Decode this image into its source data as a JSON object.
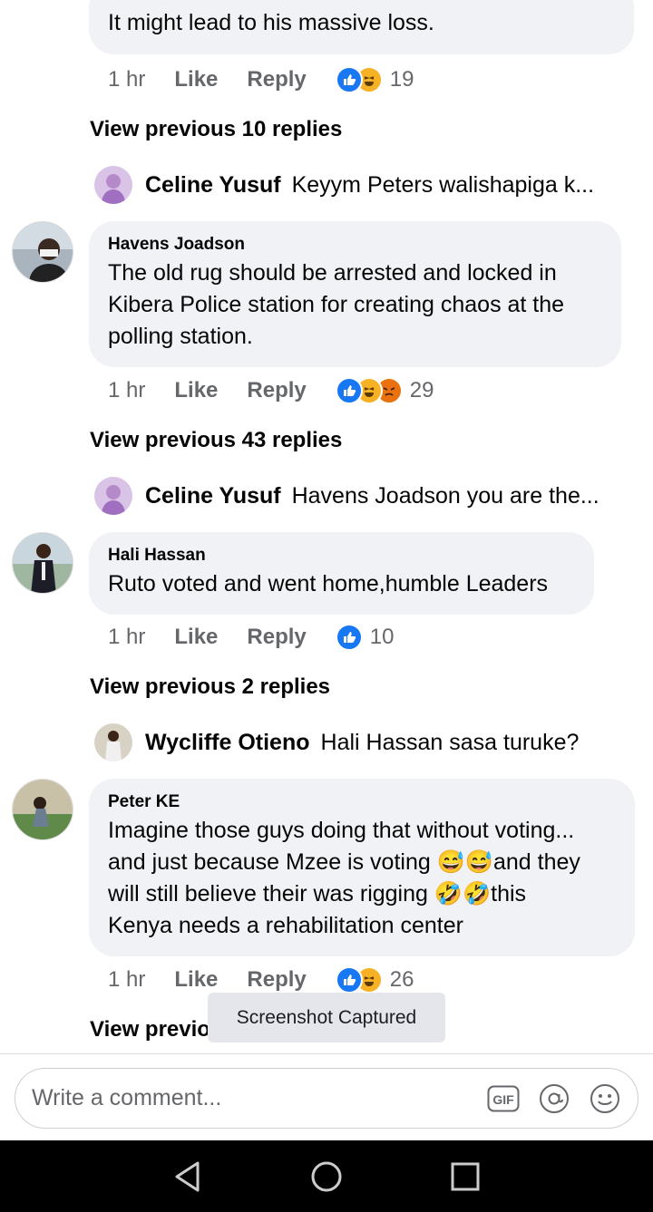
{
  "comments": [
    {
      "text": "It might lead to his massive loss.",
      "time": "1 hr",
      "like": "Like",
      "reply": "Reply",
      "count": "19",
      "view_previous": "View previous 10 replies",
      "reply_preview": {
        "name": "Celine Yusuf",
        "text": "Keyym Peters walishapiga k..."
      }
    },
    {
      "author": "Havens Joadson",
      "text_lines": [
        "The old rug should be arrested and locked in",
        "Kibera Police station for creating chaos at the",
        "polling station."
      ],
      "time": "1 hr",
      "like": "Like",
      "reply": "Reply",
      "count": "29",
      "view_previous": "View previous 43 replies",
      "reply_preview": {
        "name": "Celine Yusuf",
        "text": "Havens Joadson you are the..."
      }
    },
    {
      "author": "Hali Hassan",
      "text": "Ruto voted and went home,humble Leaders",
      "time": "1 hr",
      "like": "Like",
      "reply": "Reply",
      "count": "10",
      "view_previous": "View previous 2 replies",
      "reply_preview": {
        "name": "Wycliffe Otieno",
        "text": "Hali Hassan sasa turuke?"
      }
    },
    {
      "author": "Peter KE",
      "text_lines": [
        "Imagine those guys doing that without voting...",
        "and just because Mzee is voting 😅😅and they",
        "will still believe their was rigging 🤣🤣this",
        "Kenya needs a rehabilitation center"
      ],
      "time": "1 hr",
      "like": "Like",
      "reply": "Reply",
      "count": "26",
      "view_previous": "View previous reply"
    }
  ],
  "toast": "Screenshot Captured",
  "composer": {
    "placeholder": "Write a comment...",
    "gif_label": "GIF"
  },
  "colors": {
    "bubble": "#f0f2f5",
    "like_blue": "#1877f2",
    "haha_yellow": "#f7b125",
    "angry_orange": "#e9710f",
    "meta_gray": "#65676b"
  },
  "icons": [
    "like-reaction-icon",
    "haha-reaction-icon",
    "angry-reaction-icon",
    "gif-icon",
    "mention-icon",
    "emoji-icon",
    "back-nav-icon",
    "home-nav-icon",
    "recents-nav-icon"
  ]
}
